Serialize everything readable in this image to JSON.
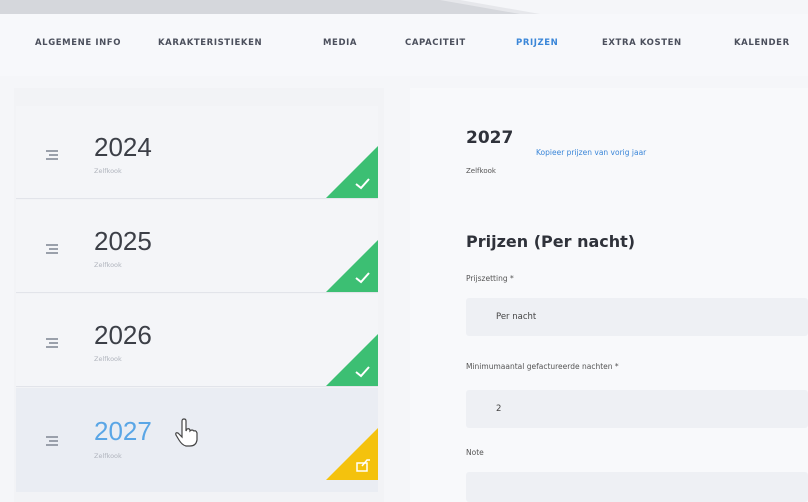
{
  "tabs": [
    {
      "label": "ALGEMENE INFO",
      "active": false
    },
    {
      "label": "KARAKTERISTIEKEN",
      "active": false
    },
    {
      "label": "MEDIA",
      "active": false
    },
    {
      "label": "CAPACITEIT",
      "active": false
    },
    {
      "label": "PRIJZEN",
      "active": true
    },
    {
      "label": "EXTRA KOSTEN",
      "active": false
    },
    {
      "label": "KALENDER",
      "active": false
    }
  ],
  "years": [
    {
      "year": "2024",
      "subtitle": "Zelfkook",
      "status": "check-icon",
      "status_color": "#3cbf73"
    },
    {
      "year": "2025",
      "subtitle": "Zelfkook",
      "status": "check-icon",
      "status_color": "#3cbf73"
    },
    {
      "year": "2026",
      "subtitle": "Zelfkook",
      "status": "check-icon",
      "status_color": "#3cbf73"
    },
    {
      "year": "2027",
      "subtitle": "Zelfkook",
      "status": "share-icon",
      "status_color": "#f4c20d",
      "selected": true
    }
  ],
  "detail": {
    "year": "2027",
    "copy_link": "Kopieer prijzen van vorig jaar",
    "subtitle": "Zelfkook",
    "section_title": "Prijzen (Per nacht)",
    "pricing_label": "Prijszetting *",
    "pricing_value": "Per nacht",
    "min_nights_label": "Minimumaantal gefactureerde nachten *",
    "min_nights_value": "2",
    "note_label": "Note",
    "note_value": ""
  },
  "colors": {
    "accent": "#3a86d8",
    "success": "#3cbf73",
    "warning": "#f4c20d"
  }
}
